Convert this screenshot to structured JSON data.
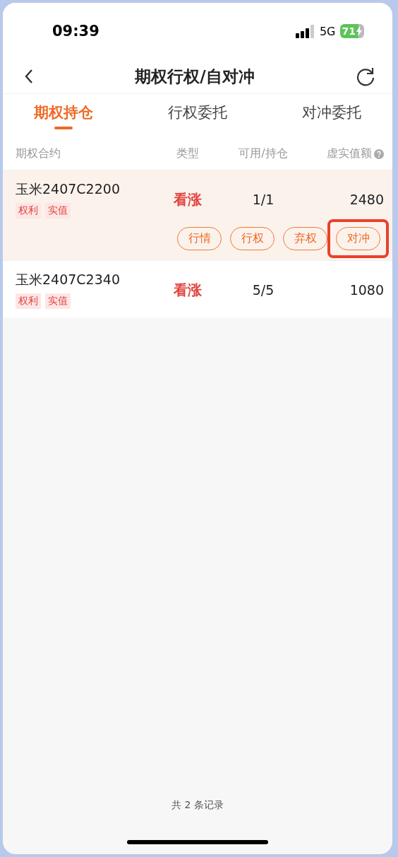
{
  "status_bar": {
    "time": "09:39",
    "network": "5G",
    "battery": "71",
    "charging": true
  },
  "nav": {
    "title": "期权行权/自对冲"
  },
  "tabs": [
    {
      "label": "期权持仓",
      "selected": true
    },
    {
      "label": "行权委托",
      "selected": false
    },
    {
      "label": "对冲委托",
      "selected": false
    }
  ],
  "table": {
    "columns": [
      "期权合约",
      "类型",
      "可用/持仓",
      "虚实值额"
    ],
    "rows": [
      {
        "contract": "玉米2407C2200",
        "tags": [
          "权利",
          "实值"
        ],
        "type": "看涨",
        "available": "1/1",
        "value": "2480",
        "expanded": true,
        "actions": [
          {
            "label": "行情",
            "highlighted": false
          },
          {
            "label": "行权",
            "highlighted": false
          },
          {
            "label": "弃权",
            "highlighted": false
          },
          {
            "label": "对冲",
            "highlighted": true
          }
        ]
      },
      {
        "contract": "玉米2407C2340",
        "tags": [
          "权利",
          "实值"
        ],
        "type": "看涨",
        "available": "5/5",
        "value": "1080",
        "expanded": false
      }
    ]
  },
  "footer": "共 2 条记录"
}
